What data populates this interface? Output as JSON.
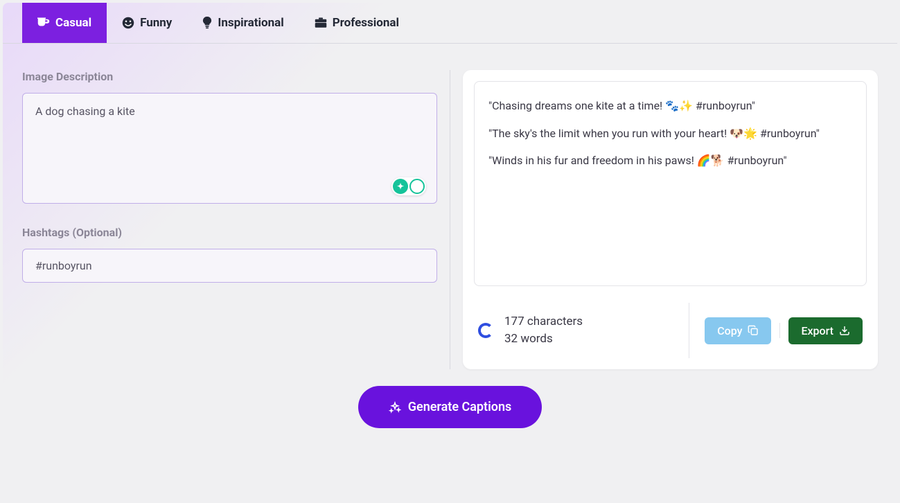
{
  "tabs": {
    "casual": "Casual",
    "funny": "Funny",
    "inspirational": "Inspirational",
    "professional": "Professional"
  },
  "fields": {
    "description_label": "Image Description",
    "description_value": "A dog chasing a kite",
    "hashtags_label": "Hashtags (Optional)",
    "hashtags_value": "#runboyrun"
  },
  "captions": {
    "c0": "\"Chasing dreams one kite at a time! 🐾✨ #runboyrun\"",
    "c1": "\"The sky's the limit when you run with your heart! 🐶🌟 #runboyrun\"",
    "c2": "\"Winds in his fur and freedom in his paws! 🌈🐕 #runboyrun\""
  },
  "stats": {
    "chars": "177 characters",
    "words": "32 words"
  },
  "actions": {
    "copy": "Copy",
    "export": "Export",
    "generate": "Generate Captions"
  }
}
